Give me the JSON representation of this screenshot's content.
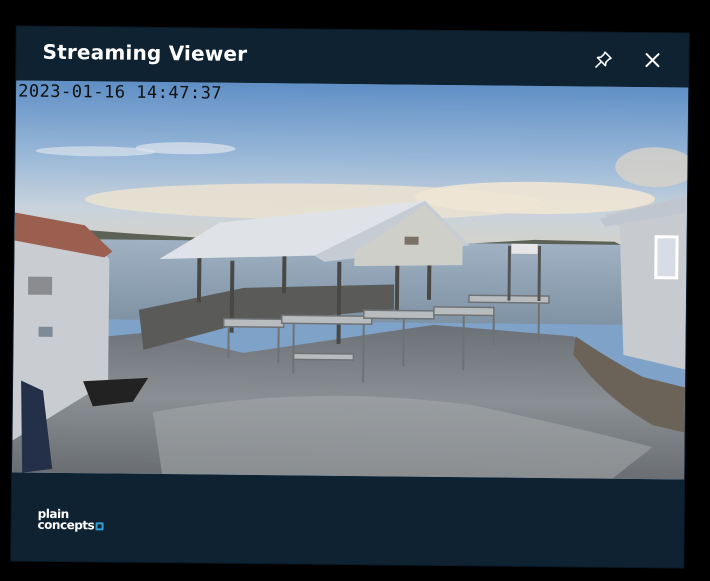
{
  "window": {
    "title": "Streaming Viewer",
    "pin_icon": "pin-icon",
    "close_icon": "close-icon"
  },
  "stream": {
    "timestamp": "2023-01-16 14:47:37"
  },
  "footer": {
    "logo_line1": "plain",
    "logo_line2": "concepts"
  },
  "colors": {
    "panel_background": "#0f2232",
    "logo_accent": "#2f9fd8",
    "title_text": "#ffffff"
  }
}
